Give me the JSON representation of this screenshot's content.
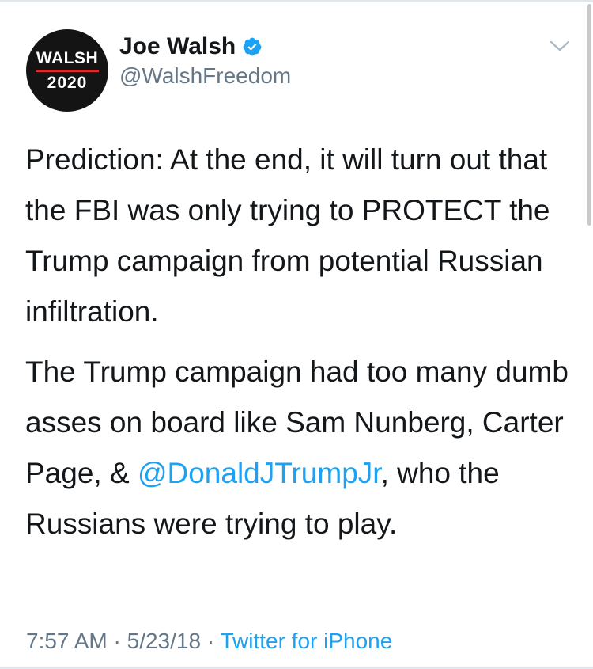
{
  "author": {
    "avatar_line1": "WALSH",
    "avatar_line2": "2020",
    "display_name": "Joe Walsh",
    "handle": "@WalshFreedom",
    "verified": true
  },
  "tweet": {
    "paragraph1": "Prediction: At the end, it will turn out that the FBI was only trying to PROTECT the Trump campaign from potential Russian infiltration.",
    "paragraph2_before_mention": "The Trump campaign had too many dumb asses on board like Sam Nunberg, Carter Page, & ",
    "mention": "@DonaldJTrumpJr",
    "paragraph2_after_mention": ", who the Russians were trying to play."
  },
  "meta": {
    "time": "7:57 AM",
    "separator": " · ",
    "date": "5/23/18",
    "source": "Twitter for iPhone"
  },
  "icons": {
    "verified": "verified-badge-icon",
    "more": "chevron-down-icon"
  },
  "colors": {
    "link_blue": "#1da1f2",
    "secondary_gray": "#657786",
    "text_black": "#14171a",
    "avatar_red_rule": "#d32d2d"
  }
}
